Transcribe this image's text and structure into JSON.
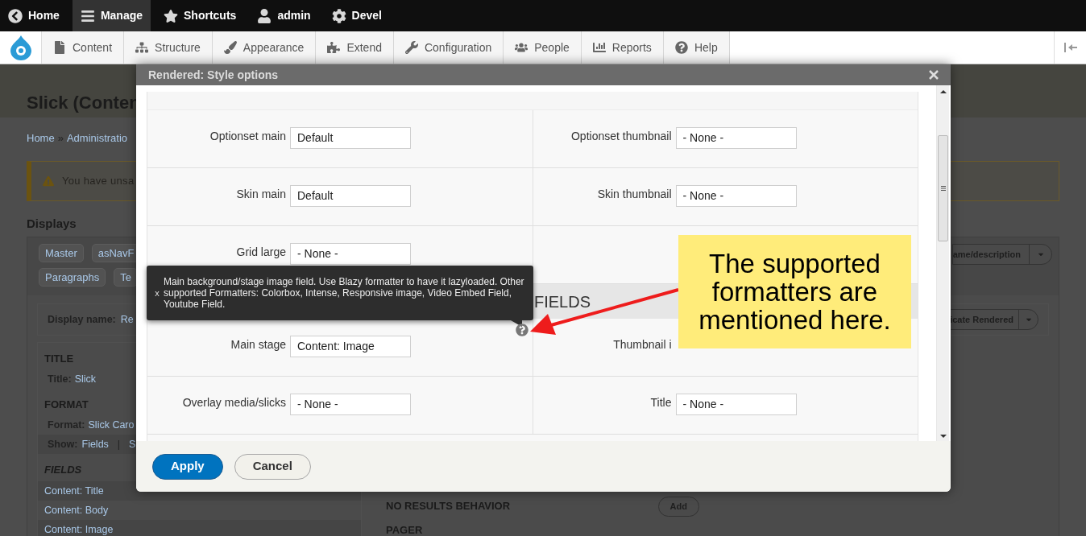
{
  "top_bar": {
    "items": [
      {
        "label": "Home",
        "selected": false
      },
      {
        "label": "Manage",
        "selected": true
      },
      {
        "label": "Shortcuts",
        "selected": false
      },
      {
        "label": "admin",
        "selected": false
      },
      {
        "label": "Devel",
        "selected": false
      }
    ]
  },
  "toolbar": {
    "items": [
      {
        "label": "Content"
      },
      {
        "label": "Structure"
      },
      {
        "label": "Appearance"
      },
      {
        "label": "Extend"
      },
      {
        "label": "Configuration"
      },
      {
        "label": "People"
      },
      {
        "label": "Reports"
      },
      {
        "label": "Help"
      }
    ]
  },
  "page": {
    "title": "Slick (Conten",
    "breadcrumb": [
      "Home",
      "»",
      "Administratio"
    ],
    "warning": "You have unsa",
    "displays_heading": "Displays",
    "display_tabs": [
      {
        "label": "Master"
      },
      {
        "label": "asNavF"
      },
      {
        "label": "Paragraphs"
      },
      {
        "label": "Te"
      }
    ],
    "display_dropdown": "ame/description",
    "display_name": {
      "label": "Display name:",
      "value": "Re"
    },
    "duplicate_dropdown": "icate Rendered",
    "left_column": [
      {
        "kind": "heading",
        "text": "TITLE"
      },
      {
        "kind": "setting",
        "label": "Title:",
        "value": "Slick"
      },
      {
        "kind": "heading",
        "text": "FORMAT"
      },
      {
        "kind": "setting",
        "label": "Format:",
        "value": "Slick Caro"
      },
      {
        "kind": "show",
        "label": "Show:",
        "value": "Fields",
        "separator": "|",
        "extra": "S"
      },
      {
        "kind": "italic_heading",
        "text": "FIELDS"
      },
      {
        "kind": "field",
        "text": "Content: Title"
      },
      {
        "kind": "field",
        "text": "Content: Body"
      },
      {
        "kind": "field",
        "text": "Content: Image"
      }
    ],
    "middle_column": [
      {
        "label": "NO RESULTS BEHAVIOR",
        "button": "Add"
      },
      {
        "label": "PAGER"
      }
    ]
  },
  "dialog": {
    "title": "Rendered: Style options",
    "rows": [
      {
        "kind": "pair",
        "left": {
          "label": "Optionset main",
          "value": "Default"
        },
        "right": {
          "label": "Optionset thumbnail",
          "value": "- None -"
        }
      },
      {
        "kind": "pair",
        "left": {
          "label": "Skin main",
          "value": "Default"
        },
        "right": {
          "label": "Skin thumbnail",
          "value": "- None -"
        }
      },
      {
        "kind": "single",
        "left": {
          "label": "Grid large",
          "value": "- None -"
        }
      },
      {
        "kind": "heading",
        "text": "FIELDS"
      },
      {
        "kind": "pair",
        "left": {
          "label": "Main stage",
          "value": "Content: Image"
        },
        "right": {
          "label": "Thumbnail i"
        }
      },
      {
        "kind": "pair",
        "left": {
          "label": "Overlay media/slicks",
          "value": "- None -"
        },
        "right": {
          "label": "Title",
          "value": "- None -"
        }
      }
    ],
    "tooltip": {
      "close": "x",
      "text": "Main background/stage image field. Use Blazy formatter to have it lazyloaded. Other supported Formatters: Colorbox, Intense, Responsive image, Video Embed Field, Youtube Field."
    },
    "buttons": [
      {
        "label": "Apply",
        "kind": "primary"
      },
      {
        "label": "Cancel",
        "kind": "secondary"
      }
    ]
  },
  "callout": {
    "text": "The supported formatters are mentioned here."
  }
}
